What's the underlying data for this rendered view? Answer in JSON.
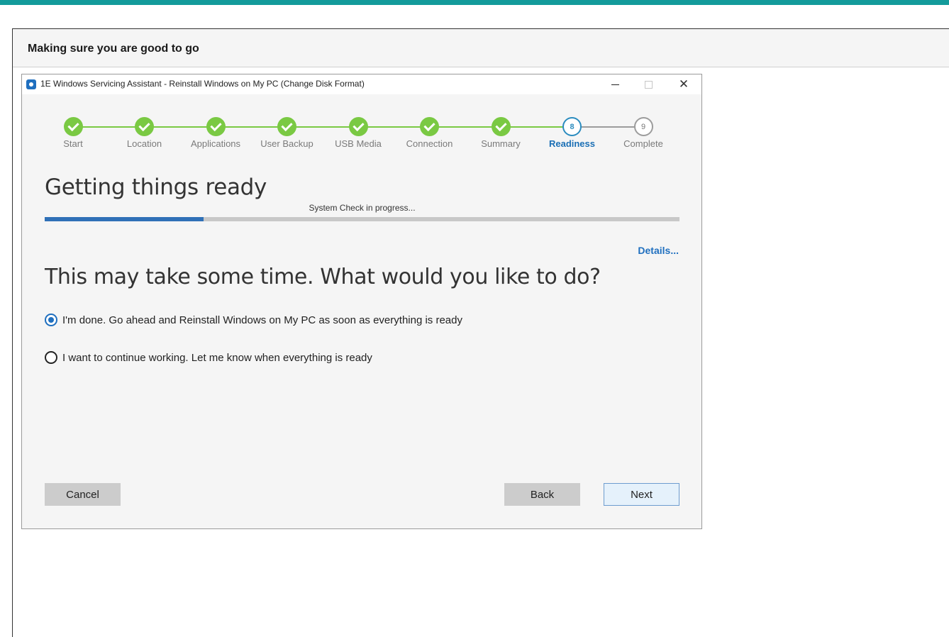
{
  "page": {
    "header_title": "Making sure you are good to go"
  },
  "window": {
    "title": "1E Windows Servicing Assistant - Reinstall Windows on My PC (Change Disk Format)",
    "close_glyph": "✕"
  },
  "steps": [
    {
      "label": "Start",
      "state": "done"
    },
    {
      "label": "Location",
      "state": "done"
    },
    {
      "label": "Applications",
      "state": "done"
    },
    {
      "label": "User Backup",
      "state": "done"
    },
    {
      "label": "USB Media",
      "state": "done"
    },
    {
      "label": "Connection",
      "state": "done"
    },
    {
      "label": "Summary",
      "state": "done"
    },
    {
      "label": "Readiness",
      "state": "active",
      "number": "8"
    },
    {
      "label": "Complete",
      "state": "todo",
      "number": "9"
    }
  ],
  "main": {
    "heading": "Getting things ready",
    "progress_label": "System Check in progress...",
    "progress_fraction": 0.25,
    "details_link": "Details...",
    "question": "This may take some time. What would you like to do?",
    "options": [
      {
        "label": "I'm done. Go ahead and Reinstall Windows on My PC as soon as everything is ready",
        "checked": true
      },
      {
        "label": "I want to continue working. Let me know when everything is ready",
        "checked": false
      }
    ]
  },
  "buttons": {
    "cancel": "Cancel",
    "back": "Back",
    "next": "Next"
  },
  "colors": {
    "accent_teal": "#139b9b",
    "step_done": "#7ac943",
    "step_active": "#2b8cbf",
    "progress": "#2f70b7",
    "link": "#1f6fbf"
  }
}
